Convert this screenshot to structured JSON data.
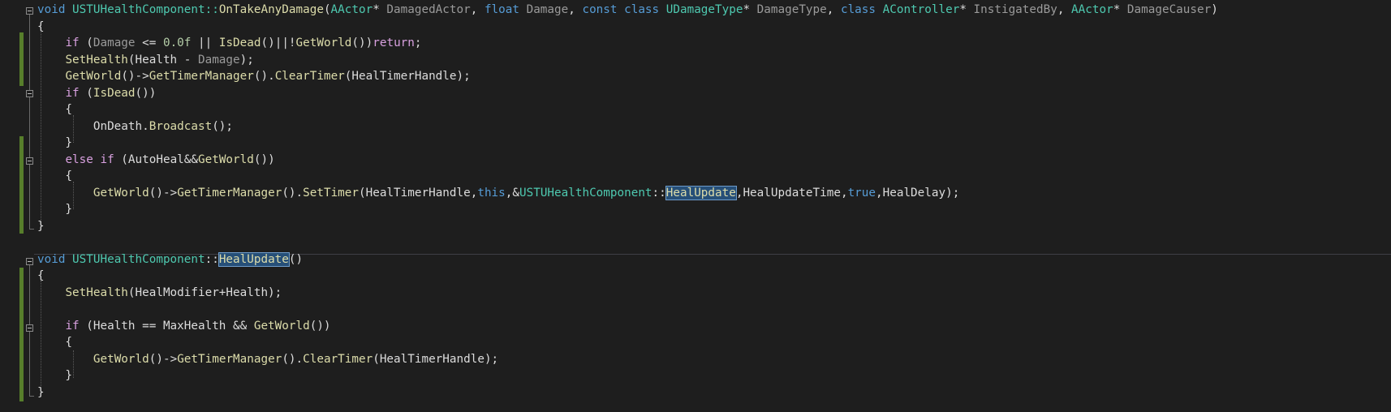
{
  "editor": {
    "lines": [
      [
        {
          "t": "void",
          "c": "kw"
        },
        {
          "t": " USTUHealthComponent::",
          "c": "cls"
        },
        {
          "t": "OnTakeAnyDamage",
          "c": "fn"
        },
        {
          "t": "(",
          "c": "txt"
        },
        {
          "t": "AActor",
          "c": "cls"
        },
        {
          "t": "* ",
          "c": "txt"
        },
        {
          "t": "DamagedActor",
          "c": "par"
        },
        {
          "t": ", ",
          "c": "txt"
        },
        {
          "t": "float",
          "c": "kw"
        },
        {
          "t": " ",
          "c": "txt"
        },
        {
          "t": "Damage",
          "c": "par"
        },
        {
          "t": ", ",
          "c": "txt"
        },
        {
          "t": "const class",
          "c": "kw"
        },
        {
          "t": " ",
          "c": "txt"
        },
        {
          "t": "UDamageType",
          "c": "cls"
        },
        {
          "t": "* ",
          "c": "txt"
        },
        {
          "t": "DamageType",
          "c": "par"
        },
        {
          "t": ", ",
          "c": "txt"
        },
        {
          "t": "class",
          "c": "kw"
        },
        {
          "t": " ",
          "c": "txt"
        },
        {
          "t": "AController",
          "c": "cls"
        },
        {
          "t": "* ",
          "c": "txt"
        },
        {
          "t": "InstigatedBy",
          "c": "par"
        },
        {
          "t": ", ",
          "c": "txt"
        },
        {
          "t": "AActor",
          "c": "cls"
        },
        {
          "t": "* ",
          "c": "txt"
        },
        {
          "t": "DamageCauser",
          "c": "par"
        },
        {
          "t": ")",
          "c": "txt"
        }
      ],
      [
        {
          "t": "{",
          "c": "txt"
        }
      ],
      [
        {
          "t": "    ",
          "c": "txt"
        },
        {
          "t": "if",
          "c": "ctl"
        },
        {
          "t": " (",
          "c": "txt"
        },
        {
          "t": "Damage",
          "c": "par"
        },
        {
          "t": " <= ",
          "c": "txt"
        },
        {
          "t": "0.0f",
          "c": "num"
        },
        {
          "t": " || ",
          "c": "txt"
        },
        {
          "t": "IsDead",
          "c": "fn"
        },
        {
          "t": "()||!",
          "c": "txt"
        },
        {
          "t": "GetWorld",
          "c": "fn"
        },
        {
          "t": "())",
          "c": "txt"
        },
        {
          "t": "return",
          "c": "ctl"
        },
        {
          "t": ";",
          "c": "txt"
        }
      ],
      [
        {
          "t": "    ",
          "c": "txt"
        },
        {
          "t": "SetHealth",
          "c": "fn"
        },
        {
          "t": "(Health - ",
          "c": "txt"
        },
        {
          "t": "Damage",
          "c": "par"
        },
        {
          "t": ");",
          "c": "txt"
        }
      ],
      [
        {
          "t": "    ",
          "c": "txt"
        },
        {
          "t": "GetWorld",
          "c": "fn"
        },
        {
          "t": "()->",
          "c": "txt"
        },
        {
          "t": "GetTimerManager",
          "c": "fn"
        },
        {
          "t": "().",
          "c": "txt"
        },
        {
          "t": "ClearTimer",
          "c": "fn"
        },
        {
          "t": "(HealTimerHandle);",
          "c": "txt"
        }
      ],
      [
        {
          "t": "    ",
          "c": "txt"
        },
        {
          "t": "if",
          "c": "ctl"
        },
        {
          "t": " (",
          "c": "txt"
        },
        {
          "t": "IsDead",
          "c": "fn"
        },
        {
          "t": "())",
          "c": "txt"
        }
      ],
      [
        {
          "t": "    {",
          "c": "txt"
        }
      ],
      [
        {
          "t": "        OnDeath.",
          "c": "txt"
        },
        {
          "t": "Broadcast",
          "c": "fn"
        },
        {
          "t": "();",
          "c": "txt"
        }
      ],
      [
        {
          "t": "    }",
          "c": "txt"
        }
      ],
      [
        {
          "t": "    ",
          "c": "txt"
        },
        {
          "t": "else if",
          "c": "ctl"
        },
        {
          "t": " (AutoHeal&&",
          "c": "txt"
        },
        {
          "t": "GetWorld",
          "c": "fn"
        },
        {
          "t": "())",
          "c": "txt"
        }
      ],
      [
        {
          "t": "    {",
          "c": "txt"
        }
      ],
      [
        {
          "t": "        ",
          "c": "txt"
        },
        {
          "t": "GetWorld",
          "c": "fn"
        },
        {
          "t": "()->",
          "c": "txt"
        },
        {
          "t": "GetTimerManager",
          "c": "fn"
        },
        {
          "t": "().",
          "c": "txt"
        },
        {
          "t": "SetTimer",
          "c": "fn"
        },
        {
          "t": "(HealTimerHandle,",
          "c": "txt"
        },
        {
          "t": "this",
          "c": "kw"
        },
        {
          "t": ",&",
          "c": "txt"
        },
        {
          "t": "USTUHealthComponent",
          "c": "cls"
        },
        {
          "t": "::",
          "c": "txt"
        },
        {
          "t": "HealUpdate",
          "c": "fn",
          "hl": true
        },
        {
          "t": ",HealUpdateTime,",
          "c": "txt"
        },
        {
          "t": "true",
          "c": "kw"
        },
        {
          "t": ",HealDelay);",
          "c": "txt"
        }
      ],
      [
        {
          "t": "    }",
          "c": "txt"
        }
      ],
      [
        {
          "t": "}",
          "c": "txt"
        }
      ],
      [],
      [
        {
          "t": "void",
          "c": "kw"
        },
        {
          "t": " ",
          "c": "txt"
        },
        {
          "t": "USTUHealthComponent",
          "c": "cls"
        },
        {
          "t": "::",
          "c": "txt"
        },
        {
          "t": "HealUpdate",
          "c": "fn",
          "hl": true
        },
        {
          "t": "()",
          "c": "txt"
        }
      ],
      [
        {
          "t": "{",
          "c": "txt"
        }
      ],
      [
        {
          "t": "    ",
          "c": "txt"
        },
        {
          "t": "SetHealth",
          "c": "fn"
        },
        {
          "t": "(HealModifier+Health);",
          "c": "txt"
        }
      ],
      [],
      [
        {
          "t": "    ",
          "c": "txt"
        },
        {
          "t": "if",
          "c": "ctl"
        },
        {
          "t": " (Health == MaxHealth && ",
          "c": "txt"
        },
        {
          "t": "GetWorld",
          "c": "fn"
        },
        {
          "t": "())",
          "c": "txt"
        }
      ],
      [
        {
          "t": "    {",
          "c": "txt"
        }
      ],
      [
        {
          "t": "        ",
          "c": "txt"
        },
        {
          "t": "GetWorld",
          "c": "fn"
        },
        {
          "t": "()->",
          "c": "txt"
        },
        {
          "t": "GetTimerManager",
          "c": "fn"
        },
        {
          "t": "().",
          "c": "txt"
        },
        {
          "t": "ClearTimer",
          "c": "fn"
        },
        {
          "t": "(HealTimerHandle);",
          "c": "txt"
        }
      ],
      [
        {
          "t": "    }",
          "c": "txt"
        }
      ],
      [
        {
          "t": "}",
          "c": "txt"
        }
      ]
    ]
  }
}
